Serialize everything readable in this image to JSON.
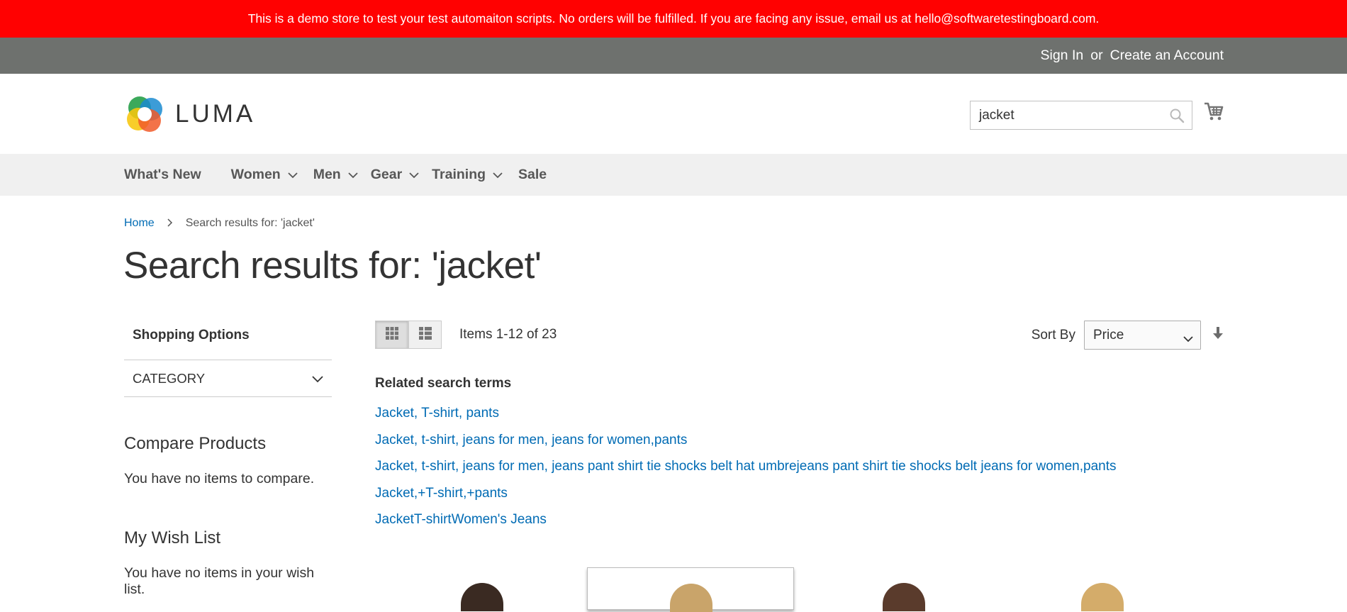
{
  "demo_notice": "This is a demo store to test your test automaiton scripts. No orders will be fulfilled. If you are facing any issue, email us at hello@softwaretestingboard.com.",
  "header": {
    "sign_in": "Sign In",
    "or": "or",
    "create_account": "Create an Account",
    "logo_text": "LUMA",
    "search_value": "jacket",
    "icons": {
      "search": "search-icon",
      "cart": "cart-icon"
    }
  },
  "nav": {
    "items": [
      {
        "label": "What's New",
        "has_dropdown": false
      },
      {
        "label": "Women",
        "has_dropdown": true
      },
      {
        "label": "Men",
        "has_dropdown": true
      },
      {
        "label": "Gear",
        "has_dropdown": true
      },
      {
        "label": "Training",
        "has_dropdown": true
      },
      {
        "label": "Sale",
        "has_dropdown": false
      }
    ]
  },
  "breadcrumb": {
    "home": "Home",
    "current": "Search results for: 'jacket'"
  },
  "page_title": "Search results for: 'jacket'",
  "sidebar": {
    "shopping_options": "Shopping Options",
    "filter_category": "CATEGORY",
    "compare_title": "Compare Products",
    "compare_text": "You have no items to compare.",
    "wishlist_title": "My Wish List",
    "wishlist_text": "You have no items in your wish list."
  },
  "toolbar": {
    "amount": "Items 1-12 of 23",
    "sort_label": "Sort By",
    "sort_value": "Price",
    "view_mode": "grid"
  },
  "related": {
    "title": "Related search terms",
    "terms": [
      "Jacket, T-shirt, pants",
      "Jacket, t-shirt, jeans for men, jeans for women,pants",
      "Jacket, t-shirt, jeans for men, jeans pant shirt tie shocks belt hat umbrejeans pant shirt tie shocks belt jeans for women,pants",
      "Jacket,+T-shirt,+pants",
      "JacketT-shirtWomen's Jeans"
    ]
  },
  "colors": {
    "demo_bar": "#ff0101",
    "top_bar": "#6e716e",
    "nav_bg": "#f0f0f0",
    "link": "#006bb4"
  }
}
